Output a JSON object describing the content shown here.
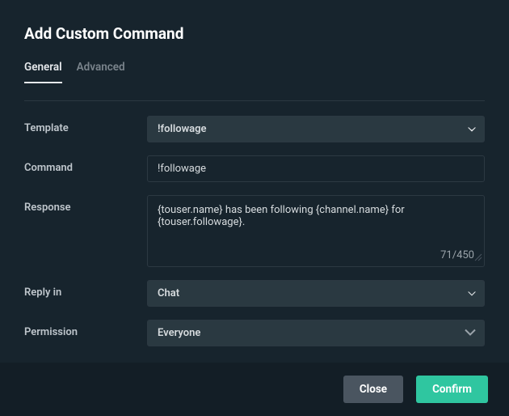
{
  "title": "Add Custom Command",
  "tabs": {
    "general": "General",
    "advanced": "Advanced"
  },
  "labels": {
    "template": "Template",
    "command": "Command",
    "response": "Response",
    "reply_in": "Reply in",
    "permission": "Permission"
  },
  "fields": {
    "template_value": "!followage",
    "command_value": "!followage",
    "response_value": "{touser.name} has been following {channel.name} for {touser.followage}.",
    "response_count": "71/450",
    "reply_in_value": "Chat",
    "permission_value": "Everyone"
  },
  "buttons": {
    "close": "Close",
    "confirm": "Confirm"
  }
}
